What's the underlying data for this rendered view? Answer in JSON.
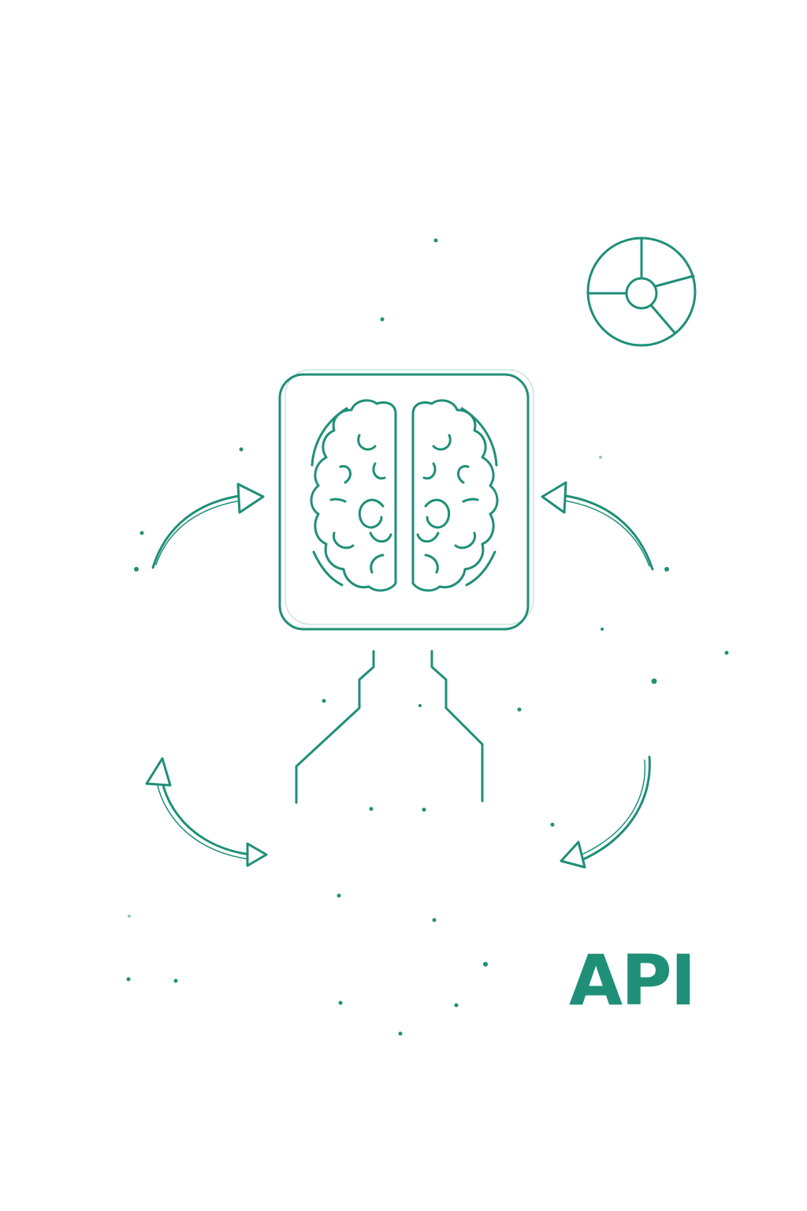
{
  "labels": {
    "api": "API"
  },
  "colors": {
    "accent": "#1f8f78",
    "background": "#ffffff"
  },
  "icons": [
    "brain-chip-icon",
    "chart-wheel-icon",
    "circuit-trace-icon",
    "cycle-arrow-icon"
  ]
}
